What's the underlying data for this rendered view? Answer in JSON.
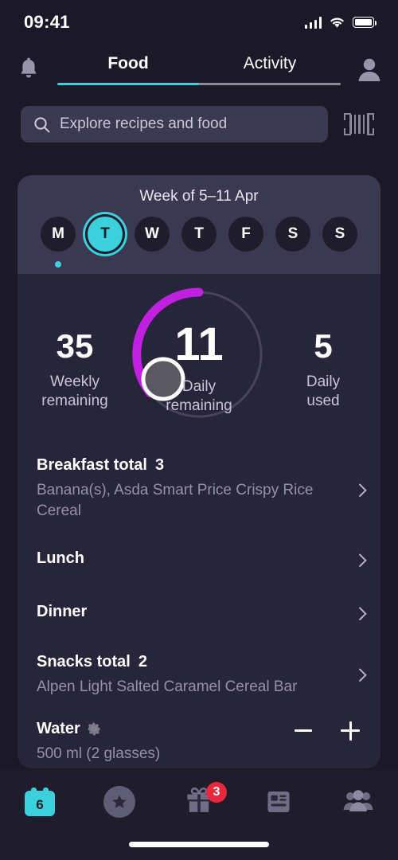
{
  "status_bar": {
    "time": "09:41",
    "signal_icon": "cellular-signal-icon",
    "wifi_icon": "wifi-icon",
    "battery_icon": "battery-icon"
  },
  "top_nav": {
    "notifications_icon": "bell-icon",
    "profile_icon": "profile-avatar-icon",
    "tabs": [
      {
        "label": "Food",
        "active": true
      },
      {
        "label": "Activity",
        "active": false
      }
    ],
    "active_indicator_color": "#3ccfdc",
    "inactive_indicator_color": "#8b8a97"
  },
  "search": {
    "placeholder": "Explore recipes and food",
    "value": "",
    "search_icon": "search-icon",
    "barcode_icon": "barcode-scanner-icon"
  },
  "week_selector": {
    "title": "Week of 5–11 Apr",
    "days": [
      {
        "label": "M",
        "selected": false,
        "dot": true
      },
      {
        "label": "T",
        "selected": true,
        "dot": false
      },
      {
        "label": "W",
        "selected": false,
        "dot": false
      },
      {
        "label": "T",
        "selected": false,
        "dot": false
      },
      {
        "label": "F",
        "selected": false,
        "dot": false
      },
      {
        "label": "S",
        "selected": false,
        "dot": false
      },
      {
        "label": "S",
        "selected": false,
        "dot": false
      }
    ]
  },
  "summary": {
    "weekly_remaining_value": "35",
    "weekly_remaining_label": "Weekly\nremaining",
    "daily_remaining_value": "11",
    "daily_remaining_label": "Daily\nremaining",
    "daily_used_value": "5",
    "daily_used_label": "Daily\nused",
    "ring_color": "#c021e0",
    "ring_track_color": "#46445c"
  },
  "meals": [
    {
      "title": "Breakfast total",
      "count": "3",
      "items": "Banana(s), Asda Smart Price Crispy Rice Cereal",
      "chevron_icon": "chevron-right-icon"
    },
    {
      "title": "Lunch",
      "count": "",
      "items": "",
      "chevron_icon": "chevron-right-icon"
    },
    {
      "title": "Dinner",
      "count": "",
      "items": "",
      "chevron_icon": "chevron-right-icon"
    },
    {
      "title": "Snacks total",
      "count": "2",
      "items": "Alpen Light Salted Caramel Cereal Bar",
      "chevron_icon": "chevron-right-icon"
    }
  ],
  "water": {
    "title": "Water",
    "settings_icon": "gear-icon",
    "amount": "500 ml (2 glasses)",
    "decrease_icon": "minus-icon",
    "increase_icon": "plus-icon"
  },
  "bottom_nav": {
    "items": [
      {
        "name": "diary",
        "icon": "calendar-icon",
        "label": "6",
        "active": true,
        "badge": ""
      },
      {
        "name": "favourites",
        "icon": "star-icon",
        "label": "",
        "active": false,
        "badge": ""
      },
      {
        "name": "rewards",
        "icon": "gift-icon",
        "label": "",
        "active": false,
        "badge": "3"
      },
      {
        "name": "news",
        "icon": "article-icon",
        "label": "",
        "active": false,
        "badge": ""
      },
      {
        "name": "community",
        "icon": "people-icon",
        "label": "",
        "active": false,
        "badge": ""
      }
    ],
    "badge_color": "#e8283c",
    "active_color": "#3ccfdc"
  }
}
